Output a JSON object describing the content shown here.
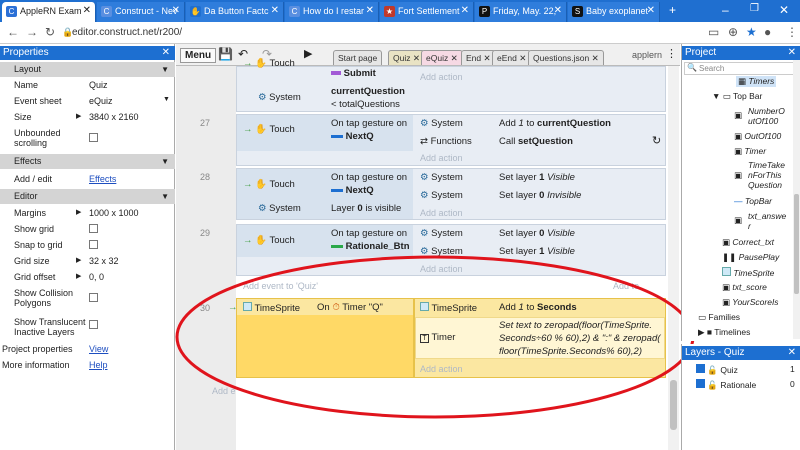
{
  "browser": {
    "tabs": [
      {
        "title": "AppleRN Exam",
        "active": true
      },
      {
        "title": "Construct - Nev",
        "active": false
      },
      {
        "title": "Da Button Factc",
        "active": false
      },
      {
        "title": "How do I restar",
        "active": false
      },
      {
        "title": "Fort Settlement",
        "active": false
      },
      {
        "title": "Friday, May. 22,",
        "active": false
      },
      {
        "title": "Baby exoplanet",
        "active": false
      }
    ],
    "url": "editor.construct.net/r200/"
  },
  "properties": {
    "title": "Properties",
    "layout_section": "Layout",
    "name_label": "Name",
    "name_value": "Quiz",
    "eventsheet_label": "Event sheet",
    "eventsheet_value": "eQuiz",
    "size_label": "Size",
    "size_value": "3840 x 2160",
    "unbounded_label": "Unbounded scrolling",
    "effects_section": "Effects",
    "addedit_label": "Add / edit",
    "addedit_link": "Effects",
    "editor_section": "Editor",
    "margins_label": "Margins",
    "margins_value": "1000 x 1000",
    "showgrid_label": "Show grid",
    "snap_label": "Snap to grid",
    "gridsize_label": "Grid size",
    "gridsize_value": "32 x 32",
    "gridoffset_label": "Grid offset",
    "gridoffset_value": "0, 0",
    "collision_label": "Show Collision Polygons",
    "translucent_label": "Show Translucent Inactive Layers",
    "projprops_label": "Project properties",
    "projprops_link": "View",
    "moreinfo_label": "More information",
    "moreinfo_link": "Help"
  },
  "editor": {
    "menu_label": "Menu",
    "tabs": [
      "Start page",
      "Quiz",
      "eQuiz",
      "End",
      "eEnd",
      "Questions.json"
    ],
    "user": "applern",
    "top_fragment": {
      "touch": "Touch",
      "system": "System",
      "submit": "Submit",
      "cq": "currentQuestion",
      "lt": "< totalQuestions",
      "add_action": "Add action"
    },
    "events": [
      {
        "num": "27",
        "trigger_obj": "Touch",
        "trigger_text": "On tap gesture on",
        "trigger_target": "NextQ",
        "actions": [
          {
            "obj": "System",
            "text_a": "Add ",
            "text_b": "1",
            "text_c": " to ",
            "text_d": "currentQuestion"
          },
          {
            "obj": "Functions",
            "text_a": "Call ",
            "text_d": "setQuestion"
          }
        ]
      },
      {
        "num": "28",
        "trigger_obj": "Touch",
        "trigger_text": "On tap gesture on",
        "trigger_target": "NextQ",
        "cond2_obj": "System",
        "cond2_text": "Layer ",
        "cond2_num": "0",
        "cond2_tail": " is visible",
        "actions": [
          {
            "obj": "System",
            "text_a": "Set layer ",
            "text_b": "1",
            "text_c": " ",
            "text_d": "Visible"
          },
          {
            "obj": "System",
            "text_a": "Set layer ",
            "text_b": "0",
            "text_c": " ",
            "text_d": "Invisible"
          }
        ]
      },
      {
        "num": "29",
        "trigger_obj": "Touch",
        "trigger_text": "On tap gesture on",
        "trigger_target": "Rationale_Btn",
        "actions": [
          {
            "obj": "System",
            "text_a": "Set layer ",
            "text_b": "0",
            "text_c": " ",
            "text_d": "Visible"
          },
          {
            "obj": "System",
            "text_a": "Set layer ",
            "text_b": "1",
            "text_c": " ",
            "text_d": "Visible"
          }
        ]
      }
    ],
    "add_event_to": "Add event to 'Quiz'",
    "add_to": "Add to",
    "ts_event": {
      "num": "30",
      "obj": "TimeSprite",
      "cond": "On",
      "cond_tail": "Timer \"Q\"",
      "a1_obj": "TimeSprite",
      "a1_text": "Add ",
      "a1_num": "1",
      "a1_to": " to ",
      "a1_var": "Seconds",
      "a2_obj": "Timer",
      "a2_line1": "Set text to zeropad(floor(TimeSprite.",
      "a2_line2": "Seconds÷60 % 60),2) & \":\" & zeropad(",
      "a2_line3": "floor(TimeSprite.Seconds% 60),2)"
    },
    "bottom_add_action": "Add action",
    "bottom_add_event": "Add e"
  },
  "project": {
    "title": "Project",
    "search_placeholder": "Search",
    "items": [
      {
        "label": "Timers",
        "italic": true
      },
      {
        "label": "Top Bar",
        "italic": false
      },
      {
        "label": "NumberO",
        "italic": true
      },
      {
        "label": "utOf100",
        "italic": true
      },
      {
        "label": "OutOf100",
        "italic": true
      },
      {
        "label": "Timer",
        "italic": true
      },
      {
        "label": "TimeTake",
        "italic": true
      },
      {
        "label": "nForThis",
        "italic": true
      },
      {
        "label": "Question",
        "italic": true
      },
      {
        "label": "TopBar",
        "italic": true
      },
      {
        "label": "txt_answe",
        "italic": true
      },
      {
        "label": "r",
        "italic": true
      },
      {
        "label": "Correct_txt",
        "italic": true
      },
      {
        "label": "PausePlay",
        "italic": true
      },
      {
        "label": "TimeSprite",
        "italic": true
      },
      {
        "label": "txt_score",
        "italic": true
      },
      {
        "label": "YourScoreIs",
        "italic": true
      },
      {
        "label": "Families",
        "italic": false
      },
      {
        "label": "Timelines",
        "italic": false
      }
    ]
  },
  "layers": {
    "title": "Layers - Quiz",
    "rows": [
      {
        "name": "Quiz",
        "index": "1"
      },
      {
        "name": "Rationale",
        "index": "0"
      }
    ]
  },
  "colors": {
    "accent": "#1d6fd1",
    "highlight": "#ffd966",
    "annotation": "#e0141c"
  }
}
